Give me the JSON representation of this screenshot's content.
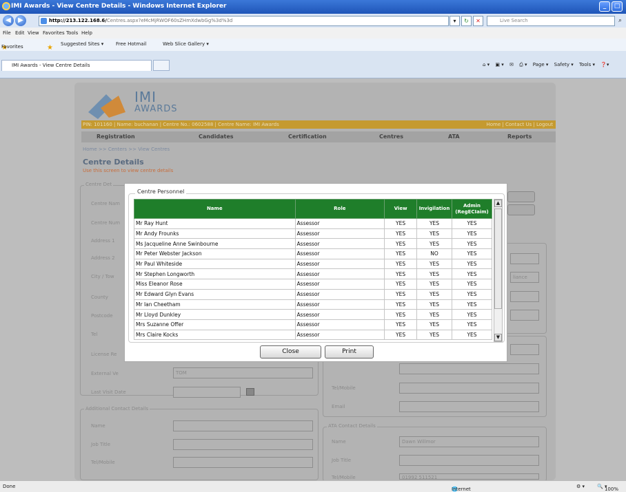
{
  "window": {
    "title": "IMI Awards - View Centre Details - Windows Internet Explorer"
  },
  "browser": {
    "url_host": "http://213.122.168.6/",
    "url_path": "Centres.aspx?eMcMjRWOF60sZHmXdwbGg%3d%3d",
    "search_placeholder": "Live Search",
    "menu": [
      "File",
      "Edit",
      "View",
      "Favorites",
      "Tools",
      "Help"
    ],
    "favorites": {
      "label": "Favorites",
      "items": [
        "Suggested Sites ▾",
        "Free Hotmail",
        "Web Slice Gallery ▾"
      ]
    },
    "tab_title": "IMI Awards - View Centre Details",
    "tools": [
      "Page ▾",
      "Safety ▾",
      "Tools ▾"
    ],
    "status_left": "Done",
    "zone": "Internet",
    "zoom": "100%"
  },
  "site": {
    "logo_line1": "IMI",
    "logo_line2": "AWARDS",
    "info_left": "PIN: 101160 | Name: buchanan | Centre No.: 0602588 | Centre Name: IMI Awards",
    "info_right": "Home | Contact Us | Logout",
    "nav": [
      "Registration",
      "Candidates",
      "Certification",
      "Centres",
      "ATA",
      "Reports"
    ],
    "breadcrumb": "Home >> Centers >> View Centres",
    "title": "Centre Details",
    "subtitle": "Use this screen to view centre details"
  },
  "form": {
    "centre_details_legend": "Centre Det",
    "left_labels": [
      "Centre Nam",
      "Centre Num",
      "Address 1",
      "Address 2",
      "City / Tow",
      "County",
      "Postcode",
      "Tel",
      "License Re",
      "External Ve",
      "Last Visit Date"
    ],
    "external_value": "TOM",
    "additional_legend": "Additional Contact Details",
    "additional_labels": [
      "Name",
      "Job Title",
      "Tel/Mobile"
    ],
    "right_labels": [
      "Tel/Mobile",
      "Email"
    ],
    "right_value_partial": "liance",
    "ata_legend": "ATA Contact Details",
    "ata_labels": [
      "Name",
      "Job Title",
      "Tel/Mobile"
    ],
    "ata_name": "Dawn Willmor",
    "ata_tel": "01992 511521"
  },
  "modal": {
    "legend": "Centre Personnel",
    "columns": [
      "Name",
      "Role",
      "View",
      "Invigilation",
      "Admin (RegECIaim)"
    ],
    "rows": [
      [
        "Mr Ray Hunt",
        "Assessor",
        "YES",
        "YES",
        "YES"
      ],
      [
        "Mr Andy Frounks",
        "Assessor",
        "YES",
        "YES",
        "YES"
      ],
      [
        "Ms Jacqueline Anne Swinbourne",
        "Assessor",
        "YES",
        "YES",
        "YES"
      ],
      [
        "Mr Peter Webster Jackson",
        "Assessor",
        "YES",
        "NO",
        "YES"
      ],
      [
        "Mr Paul Whiteside",
        "Assessor",
        "YES",
        "YES",
        "YES"
      ],
      [
        "Mr Stephen Longworth",
        "Assessor",
        "YES",
        "YES",
        "YES"
      ],
      [
        "Miss Eleanor Rose",
        "Assessor",
        "YES",
        "YES",
        "YES"
      ],
      [
        "Mr Edward Glyn Evans",
        "Assessor",
        "YES",
        "YES",
        "YES"
      ],
      [
        "Mr Ian Cheetham",
        "Assessor",
        "YES",
        "YES",
        "YES"
      ],
      [
        "Mr Lloyd Dunkley",
        "Assessor",
        "YES",
        "YES",
        "YES"
      ],
      [
        "Mrs Suzanne Offer",
        "Assessor",
        "YES",
        "YES",
        "YES"
      ],
      [
        "Mrs Claire Kocks",
        "Assessor",
        "YES",
        "YES",
        "YES"
      ]
    ],
    "close_label": "Close",
    "print_label": "Print"
  },
  "colors": {
    "grid_header": "#1f7e2a",
    "info_bar": "#c59a30",
    "title_bar": "#2a62c9"
  }
}
